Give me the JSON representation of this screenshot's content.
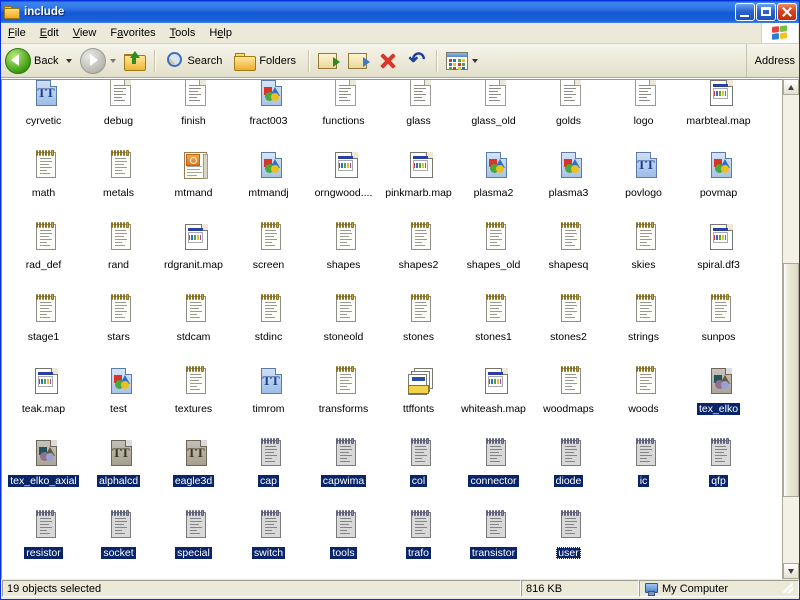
{
  "window": {
    "title": "include",
    "folder_icon": "folder-icon",
    "caption": {
      "minimize": "minimize-button",
      "maximize": "maximize-button",
      "close": "close-button"
    }
  },
  "menubar": {
    "items": [
      "File",
      "Edit",
      "View",
      "Favorites",
      "Tools",
      "Help"
    ],
    "brand_icon": "windows-flag-icon"
  },
  "toolbar": {
    "back_label": "Back",
    "search_label": "Search",
    "folders_label": "Folders",
    "address_label": "Address",
    "icons": {
      "back": "back-arrow-icon",
      "forward": "forward-arrow-icon",
      "up": "up-one-level-icon",
      "search": "search-magnifier-icon",
      "folders": "folders-icon",
      "move_to": "move-to-folder-icon",
      "copy_to": "copy-to-folder-icon",
      "delete": "delete-x-icon",
      "undo": "undo-icon",
      "views": "views-icon"
    }
  },
  "statusbar": {
    "selection": "19 objects selected",
    "size": "816 KB",
    "location": "My Computer",
    "location_icon": "my-computer-icon"
  },
  "files": [
    {
      "name": "cyrvetic",
      "type": "tt",
      "selected": false
    },
    {
      "name": "debug",
      "type": "doc",
      "selected": false
    },
    {
      "name": "finish",
      "type": "doc",
      "selected": false
    },
    {
      "name": "fract003",
      "type": "pov",
      "selected": false
    },
    {
      "name": "functions",
      "type": "doc",
      "selected": false
    },
    {
      "name": "glass",
      "type": "doc",
      "selected": false
    },
    {
      "name": "glass_old",
      "type": "doc",
      "selected": false
    },
    {
      "name": "golds",
      "type": "doc",
      "selected": false
    },
    {
      "name": "logo",
      "type": "doc",
      "selected": false
    },
    {
      "name": "marbteal.map",
      "type": "map",
      "selected": false
    },
    {
      "name": "math",
      "type": "note",
      "selected": false
    },
    {
      "name": "metals",
      "type": "note",
      "selected": false
    },
    {
      "name": "mtmand",
      "type": "ppt",
      "selected": false
    },
    {
      "name": "mtmandj",
      "type": "pov",
      "selected": false
    },
    {
      "name": "orngwood....",
      "type": "map",
      "selected": false
    },
    {
      "name": "pinkmarb.map",
      "type": "map",
      "selected": false
    },
    {
      "name": "plasma2",
      "type": "pov",
      "selected": false
    },
    {
      "name": "plasma3",
      "type": "pov",
      "selected": false
    },
    {
      "name": "povlogo",
      "type": "tt",
      "selected": false
    },
    {
      "name": "povmap",
      "type": "pov",
      "selected": false
    },
    {
      "name": "rad_def",
      "type": "note",
      "selected": false
    },
    {
      "name": "rand",
      "type": "note",
      "selected": false
    },
    {
      "name": "rdgranit.map",
      "type": "map",
      "selected": false
    },
    {
      "name": "screen",
      "type": "note",
      "selected": false
    },
    {
      "name": "shapes",
      "type": "note",
      "selected": false
    },
    {
      "name": "shapes2",
      "type": "note",
      "selected": false
    },
    {
      "name": "shapes_old",
      "type": "note",
      "selected": false
    },
    {
      "name": "shapesq",
      "type": "note",
      "selected": false
    },
    {
      "name": "skies",
      "type": "note",
      "selected": false
    },
    {
      "name": "spiral.df3",
      "type": "map",
      "selected": false
    },
    {
      "name": "stage1",
      "type": "note",
      "selected": false
    },
    {
      "name": "stars",
      "type": "note",
      "selected": false
    },
    {
      "name": "stdcam",
      "type": "note",
      "selected": false
    },
    {
      "name": "stdinc",
      "type": "note",
      "selected": false
    },
    {
      "name": "stoneold",
      "type": "note",
      "selected": false
    },
    {
      "name": "stones",
      "type": "note",
      "selected": false
    },
    {
      "name": "stones1",
      "type": "note",
      "selected": false
    },
    {
      "name": "stones2",
      "type": "note",
      "selected": false
    },
    {
      "name": "strings",
      "type": "note",
      "selected": false
    },
    {
      "name": "sunpos",
      "type": "note",
      "selected": false
    },
    {
      "name": "teak.map",
      "type": "map",
      "selected": false
    },
    {
      "name": "test",
      "type": "pov",
      "selected": false
    },
    {
      "name": "textures",
      "type": "note",
      "selected": false
    },
    {
      "name": "timrom",
      "type": "tt",
      "selected": false
    },
    {
      "name": "transforms",
      "type": "note",
      "selected": false
    },
    {
      "name": "ttffonts",
      "type": "stack",
      "selected": false
    },
    {
      "name": "whiteash.map",
      "type": "map",
      "selected": false
    },
    {
      "name": "woodmaps",
      "type": "note",
      "selected": false
    },
    {
      "name": "woods",
      "type": "note",
      "selected": false
    },
    {
      "name": "tex_elko",
      "type": "pov",
      "selected": true
    },
    {
      "name": "tex_elko_axial",
      "type": "pov",
      "selected": true
    },
    {
      "name": "alphalcd",
      "type": "tt",
      "selected": true
    },
    {
      "name": "eagle3d",
      "type": "tt",
      "selected": true
    },
    {
      "name": "cap",
      "type": "note",
      "selected": true
    },
    {
      "name": "capwima",
      "type": "note",
      "selected": true
    },
    {
      "name": "col",
      "type": "note",
      "selected": true
    },
    {
      "name": "connector",
      "type": "note",
      "selected": true
    },
    {
      "name": "diode",
      "type": "note",
      "selected": true
    },
    {
      "name": "ic",
      "type": "note",
      "selected": true
    },
    {
      "name": "qfp",
      "type": "note",
      "selected": true
    },
    {
      "name": "resistor",
      "type": "note",
      "selected": true
    },
    {
      "name": "socket",
      "type": "note",
      "selected": true
    },
    {
      "name": "special",
      "type": "note",
      "selected": true
    },
    {
      "name": "switch",
      "type": "note",
      "selected": true
    },
    {
      "name": "tools",
      "type": "note",
      "selected": true
    },
    {
      "name": "trafo",
      "type": "note",
      "selected": true
    },
    {
      "name": "transistor",
      "type": "note",
      "selected": true
    },
    {
      "name": "user",
      "type": "note",
      "selected": true,
      "focused": true
    }
  ],
  "colors": {
    "title_blue": "#1b5fd8",
    "selection_blue": "#0a246a",
    "chrome": "#ece9d8"
  }
}
